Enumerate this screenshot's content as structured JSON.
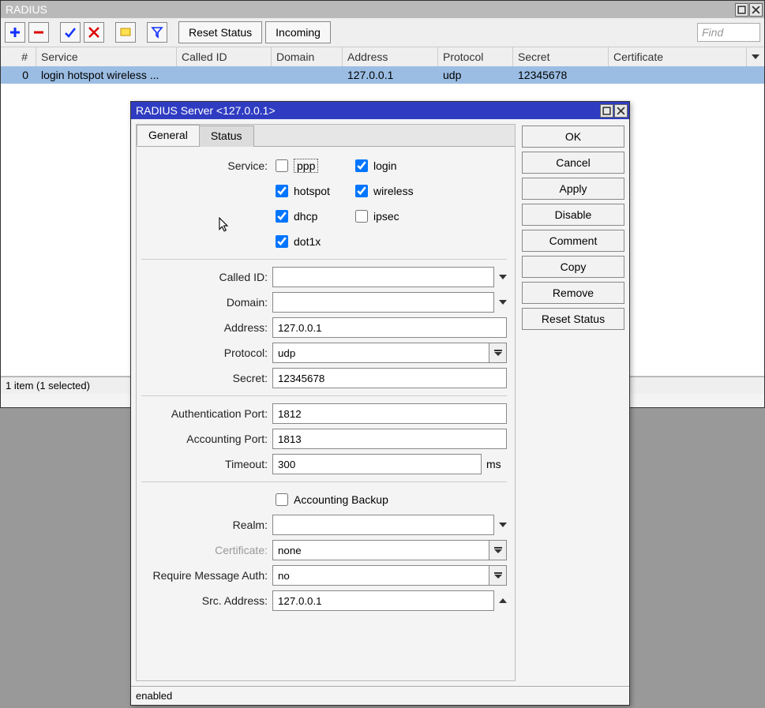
{
  "main_window": {
    "title": "RADIUS",
    "find_placeholder": "Find",
    "buttons": {
      "reset_status": "Reset Status",
      "incoming": "Incoming"
    },
    "columns": {
      "num": "#",
      "service": "Service",
      "called_id": "Called ID",
      "domain": "Domain",
      "address": "Address",
      "protocol": "Protocol",
      "secret": "Secret",
      "certificate": "Certificate"
    },
    "rows": [
      {
        "num": "0",
        "service": "login hotspot wireless ...",
        "called_id": "",
        "domain": "",
        "address": "127.0.0.1",
        "protocol": "udp",
        "secret": "12345678",
        "certificate": ""
      }
    ],
    "statusbar": "1 item (1 selected)"
  },
  "dialog": {
    "title": "RADIUS Server <127.0.0.1>",
    "tabs": {
      "general": "General",
      "status": "Status"
    },
    "labels": {
      "service": "Service:",
      "called_id": "Called ID:",
      "domain": "Domain:",
      "address": "Address:",
      "protocol": "Protocol:",
      "secret": "Secret:",
      "auth_port": "Authentication Port:",
      "acct_port": "Accounting Port:",
      "timeout": "Timeout:",
      "accounting_backup": "Accounting Backup",
      "realm": "Realm:",
      "certificate": "Certificate:",
      "require_msg_auth": "Require Message Auth:",
      "src_address": "Src. Address:"
    },
    "services": {
      "ppp": "ppp",
      "login": "login",
      "hotspot": "hotspot",
      "wireless": "wireless",
      "dhcp": "dhcp",
      "ipsec": "ipsec",
      "dot1x": "dot1x"
    },
    "values": {
      "called_id": "",
      "domain": "",
      "address": "127.0.0.1",
      "protocol": "udp",
      "secret": "12345678",
      "auth_port": "1812",
      "acct_port": "1813",
      "timeout": "300",
      "timeout_unit": "ms",
      "realm": "",
      "certificate": "none",
      "require_msg_auth": "no",
      "src_address": "127.0.0.1"
    },
    "buttons": {
      "ok": "OK",
      "cancel": "Cancel",
      "apply": "Apply",
      "disable": "Disable",
      "comment": "Comment",
      "copy": "Copy",
      "remove": "Remove",
      "reset_status": "Reset Status"
    },
    "status": "enabled"
  }
}
